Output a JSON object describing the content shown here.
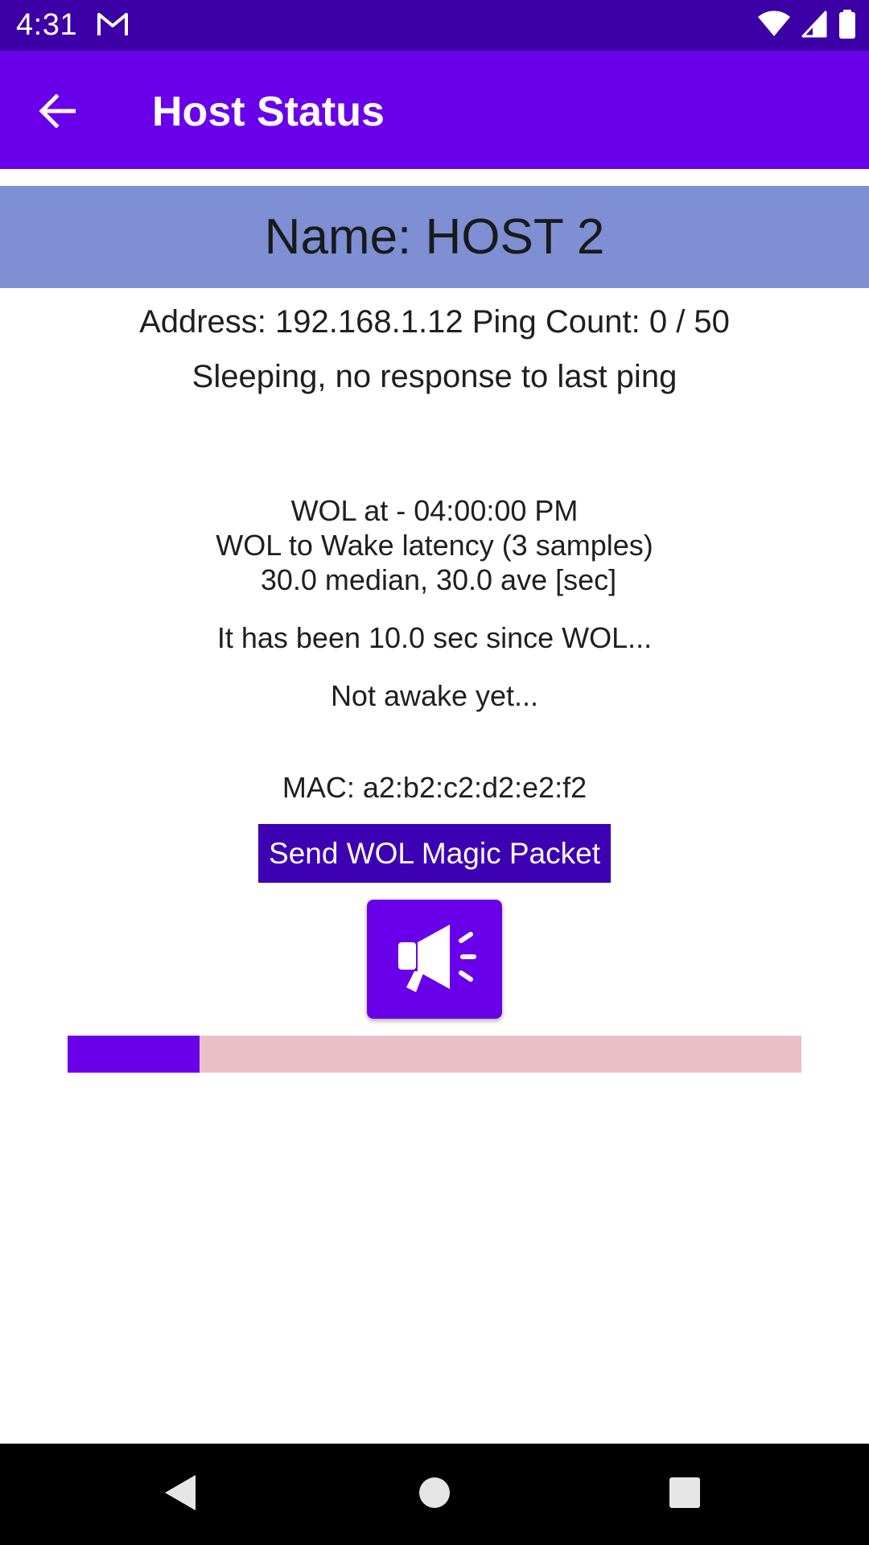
{
  "status_bar": {
    "time": "4:31",
    "icons": [
      "gmail-icon",
      "wifi-icon",
      "signal-icon",
      "battery-icon"
    ]
  },
  "app_bar": {
    "title": "Host Status",
    "back_icon": "arrow-back-icon"
  },
  "host": {
    "name_line": "Name: HOST 2",
    "address_line": "Address: 192.168.1.12 Ping Count: 0 / 50",
    "status_line": "Sleeping, no response to last ping",
    "wol_info": [
      "WOL at - 04:00:00 PM",
      "WOL to Wake latency (3 samples)",
      " 30.0 median, 30.0 ave [sec]"
    ],
    "since_line": "It has been 10.0 sec since WOL...",
    "awake_line": "Not awake yet...",
    "mac_line": "MAC: a2:b2:c2:d2:e2:f2"
  },
  "actions": {
    "send_wol_label": "Send WOL Magic Packet",
    "megaphone_icon": "megaphone-icon"
  },
  "progress": {
    "fraction": 0.18
  },
  "colors": {
    "status_bar": "#3d00a6",
    "app_bar": "#6a00ea",
    "name_banner": "#7f8fd4",
    "wol_button": "#3d00b3",
    "progress_fill": "#6a00ea",
    "progress_track": "#ebbfc8"
  },
  "nav_bar": {
    "icons": [
      "nav-back-icon",
      "nav-home-icon",
      "nav-recents-icon"
    ]
  }
}
